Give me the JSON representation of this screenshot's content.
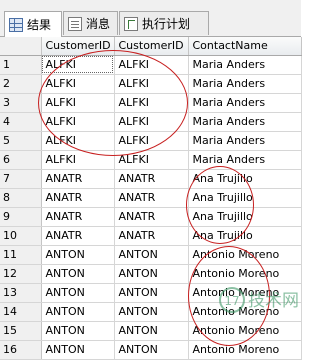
{
  "tabs": [
    {
      "label": "结果",
      "icon": "results-grid-icon"
    },
    {
      "label": "消息",
      "icon": "messages-icon"
    },
    {
      "label": "执行计划",
      "icon": "execution-plan-icon"
    }
  ],
  "grid": {
    "columns": [
      "CustomerID",
      "CustomerID",
      "ContactName"
    ],
    "rows": [
      {
        "n": "1",
        "a": "ALFKI",
        "b": "ALFKI",
        "c": "Maria Anders"
      },
      {
        "n": "2",
        "a": "ALFKI",
        "b": "ALFKI",
        "c": "Maria Anders"
      },
      {
        "n": "3",
        "a": "ALFKI",
        "b": "ALFKI",
        "c": "Maria Anders"
      },
      {
        "n": "4",
        "a": "ALFKI",
        "b": "ALFKI",
        "c": "Maria Anders"
      },
      {
        "n": "5",
        "a": "ALFKI",
        "b": "ALFKI",
        "c": "Maria Anders"
      },
      {
        "n": "6",
        "a": "ALFKI",
        "b": "ALFKI",
        "c": "Maria Anders"
      },
      {
        "n": "7",
        "a": "ANATR",
        "b": "ANATR",
        "c": "Ana Trujillo"
      },
      {
        "n": "8",
        "a": "ANATR",
        "b": "ANATR",
        "c": "Ana Trujillo"
      },
      {
        "n": "9",
        "a": "ANATR",
        "b": "ANATR",
        "c": "Ana Trujillo"
      },
      {
        "n": "10",
        "a": "ANATR",
        "b": "ANATR",
        "c": "Ana Trujillo"
      },
      {
        "n": "11",
        "a": "ANTON",
        "b": "ANTON",
        "c": "Antonio Moreno"
      },
      {
        "n": "12",
        "a": "ANTON",
        "b": "ANTON",
        "c": "Antonio Moreno"
      },
      {
        "n": "13",
        "a": "ANTON",
        "b": "ANTON",
        "c": "Antonio Moreno"
      },
      {
        "n": "14",
        "a": "ANTON",
        "b": "ANTON",
        "c": "Antonio Moreno"
      },
      {
        "n": "15",
        "a": "ANTON",
        "b": "ANTON",
        "c": "Antonio Moreno"
      },
      {
        "n": "16",
        "a": "ANTON",
        "b": "ANTON",
        "c": "Antonio Moreno"
      }
    ]
  },
  "watermark": {
    "text": "17 技术网"
  },
  "colors": {
    "annotation": "#c72020",
    "watermark": "#2f8f5a"
  }
}
